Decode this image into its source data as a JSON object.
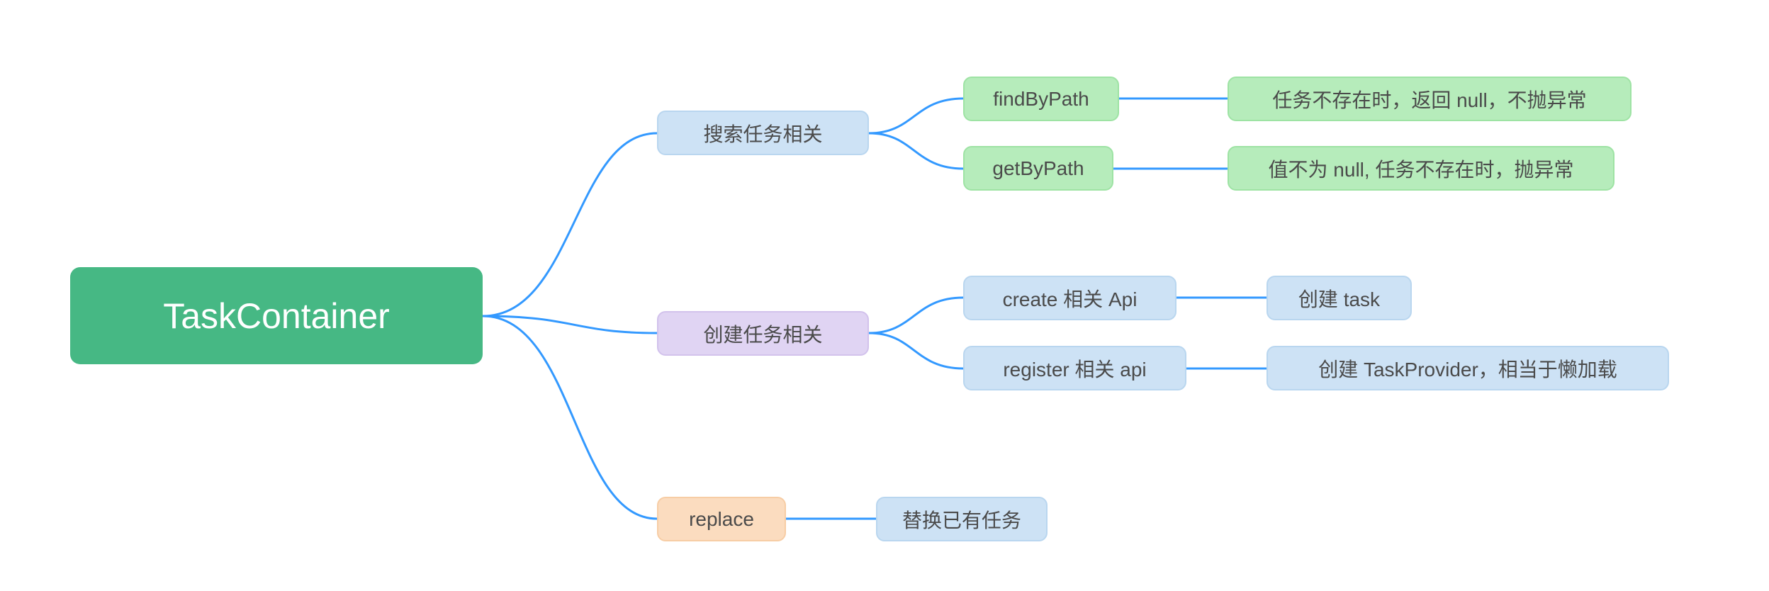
{
  "mindmap": {
    "root": {
      "label": "TaskContainer"
    },
    "branches": {
      "search": {
        "label": "搜索任务相关",
        "children": {
          "findByPath": {
            "label": "findByPath",
            "desc": "任务不存在时，返回 null，不抛异常"
          },
          "getByPath": {
            "label": "getByPath",
            "desc": "值不为 null, 任务不存在时，抛异常"
          }
        }
      },
      "create": {
        "label": "创建任务相关",
        "children": {
          "create": {
            "label": "create 相关 Api",
            "desc": "创建 task"
          },
          "register": {
            "label": "register 相关 api",
            "desc": "创建 TaskProvider，相当于懒加载"
          }
        }
      },
      "replace": {
        "label": "replace",
        "desc": "替换已有任务"
      }
    }
  },
  "colors": {
    "link": "#3399ff",
    "root": "#46b884",
    "blue": "#cde2f5",
    "green": "#b6ecbb",
    "purple": "#e0d4f3",
    "orange": "#fbdcbf"
  }
}
